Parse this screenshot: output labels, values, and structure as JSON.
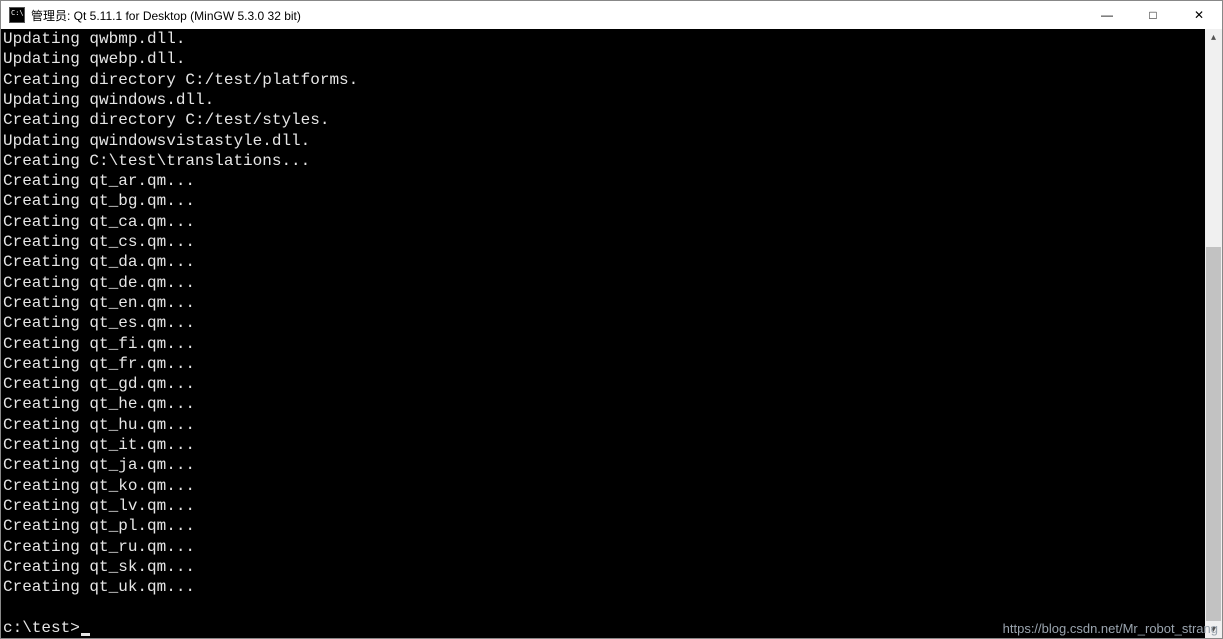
{
  "window": {
    "title": "管理员: Qt 5.11.1 for Desktop (MinGW 5.3.0 32 bit)"
  },
  "controls": {
    "minimize": "—",
    "maximize": "□",
    "close": "✕"
  },
  "scrollbar": {
    "up": "▴",
    "down": "▾"
  },
  "terminal": {
    "lines": [
      "Updating qwbmp.dll.",
      "Updating qwebp.dll.",
      "Creating directory C:/test/platforms.",
      "Updating qwindows.dll.",
      "Creating directory C:/test/styles.",
      "Updating qwindowsvistastyle.dll.",
      "Creating C:\\test\\translations...",
      "Creating qt_ar.qm...",
      "Creating qt_bg.qm...",
      "Creating qt_ca.qm...",
      "Creating qt_cs.qm...",
      "Creating qt_da.qm...",
      "Creating qt_de.qm...",
      "Creating qt_en.qm...",
      "Creating qt_es.qm...",
      "Creating qt_fi.qm...",
      "Creating qt_fr.qm...",
      "Creating qt_gd.qm...",
      "Creating qt_he.qm...",
      "Creating qt_hu.qm...",
      "Creating qt_it.qm...",
      "Creating qt_ja.qm...",
      "Creating qt_ko.qm...",
      "Creating qt_lv.qm...",
      "Creating qt_pl.qm...",
      "Creating qt_ru.qm...",
      "Creating qt_sk.qm...",
      "Creating qt_uk.qm..."
    ],
    "prompt": "c:\\test>"
  },
  "watermark": "https://blog.csdn.net/Mr_robot_strang"
}
